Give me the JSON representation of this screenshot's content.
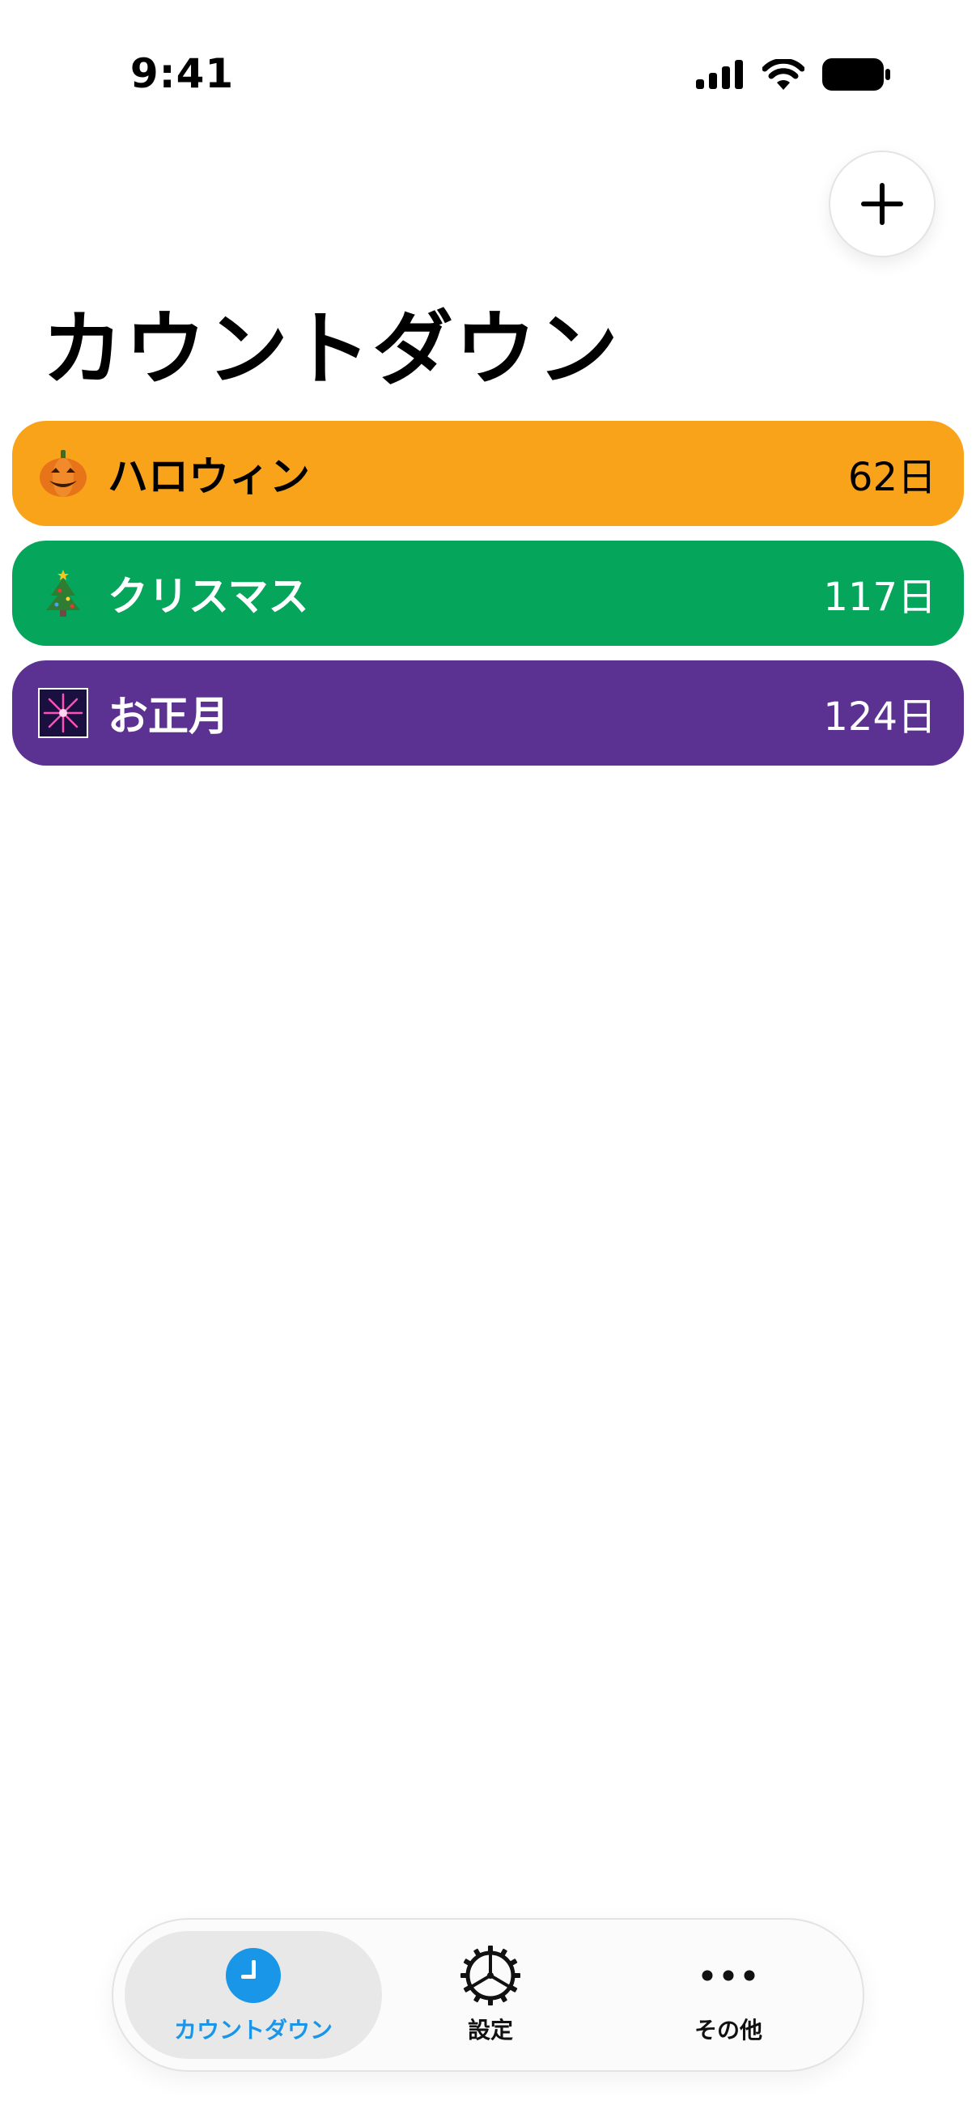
{
  "status_bar": {
    "time": "9:41",
    "icons": [
      "cellular-signal-icon",
      "wifi-icon",
      "battery-icon"
    ]
  },
  "header": {
    "add_button_icon": "plus-icon",
    "title": "カウントダウン"
  },
  "countdowns": [
    {
      "emoji": "pumpkin-icon",
      "name": "ハロウィン",
      "days": "62日",
      "color": "#f9a31b"
    },
    {
      "emoji": "christmas-tree-icon",
      "name": "クリスマス",
      "days": "117日",
      "color": "#05a55b"
    },
    {
      "emoji": "fireworks-icon",
      "name": "お正月",
      "days": "124日",
      "color": "#5b3191"
    }
  ],
  "tab_bar": {
    "selected": 0,
    "accent_color": "#1a96e9",
    "tabs": [
      {
        "label": "カウントダウン",
        "icon": "clock-icon"
      },
      {
        "label": "設定",
        "icon": "gear-icon"
      },
      {
        "label": "その他",
        "icon": "more-icon"
      }
    ]
  }
}
